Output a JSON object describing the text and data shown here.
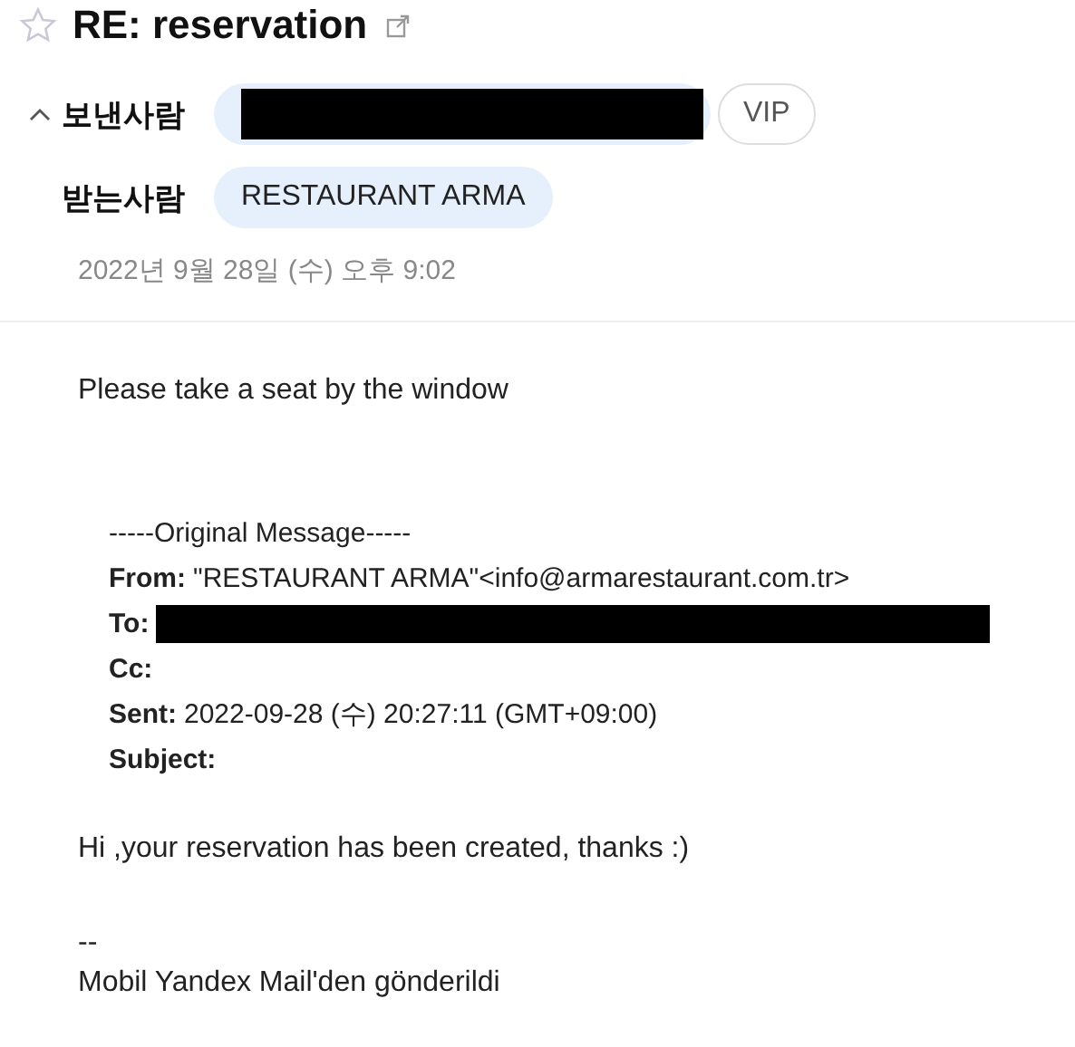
{
  "header": {
    "starred": false,
    "subject": "RE: reservation",
    "expanded": true,
    "fields": [
      {
        "label": "보낸사람",
        "chips": [
          {
            "kind": "redacted"
          }
        ],
        "vip": "VIP"
      },
      {
        "label": "받는사람",
        "chips": [
          {
            "kind": "text",
            "text": "RESTAURANT ARMA"
          }
        ]
      }
    ],
    "date": "2022년 9월 28일 (수) 오후 9:02"
  },
  "body": {
    "intro": "Please take a seat by the window",
    "quote": {
      "separator": "-----Original Message-----",
      "lines": [
        {
          "label": "From:",
          "kind": "text",
          "value": "\"RESTAURANT ARMA\"<info@armarestaurant.com.tr>"
        },
        {
          "label": "To:",
          "kind": "redacted"
        },
        {
          "label": "Cc:",
          "kind": "text"
        },
        {
          "label": "Sent:",
          "kind": "text",
          "value": "2022-09-28 (수) 20:27:11 (GMT+09:00)"
        },
        {
          "label": "Subject:",
          "kind": "text"
        }
      ]
    },
    "message": "Hi ,your reservation has been created, thanks :)",
    "signature_rule": "--",
    "signature": "Mobil Yandex Mail'den gönderildi"
  }
}
